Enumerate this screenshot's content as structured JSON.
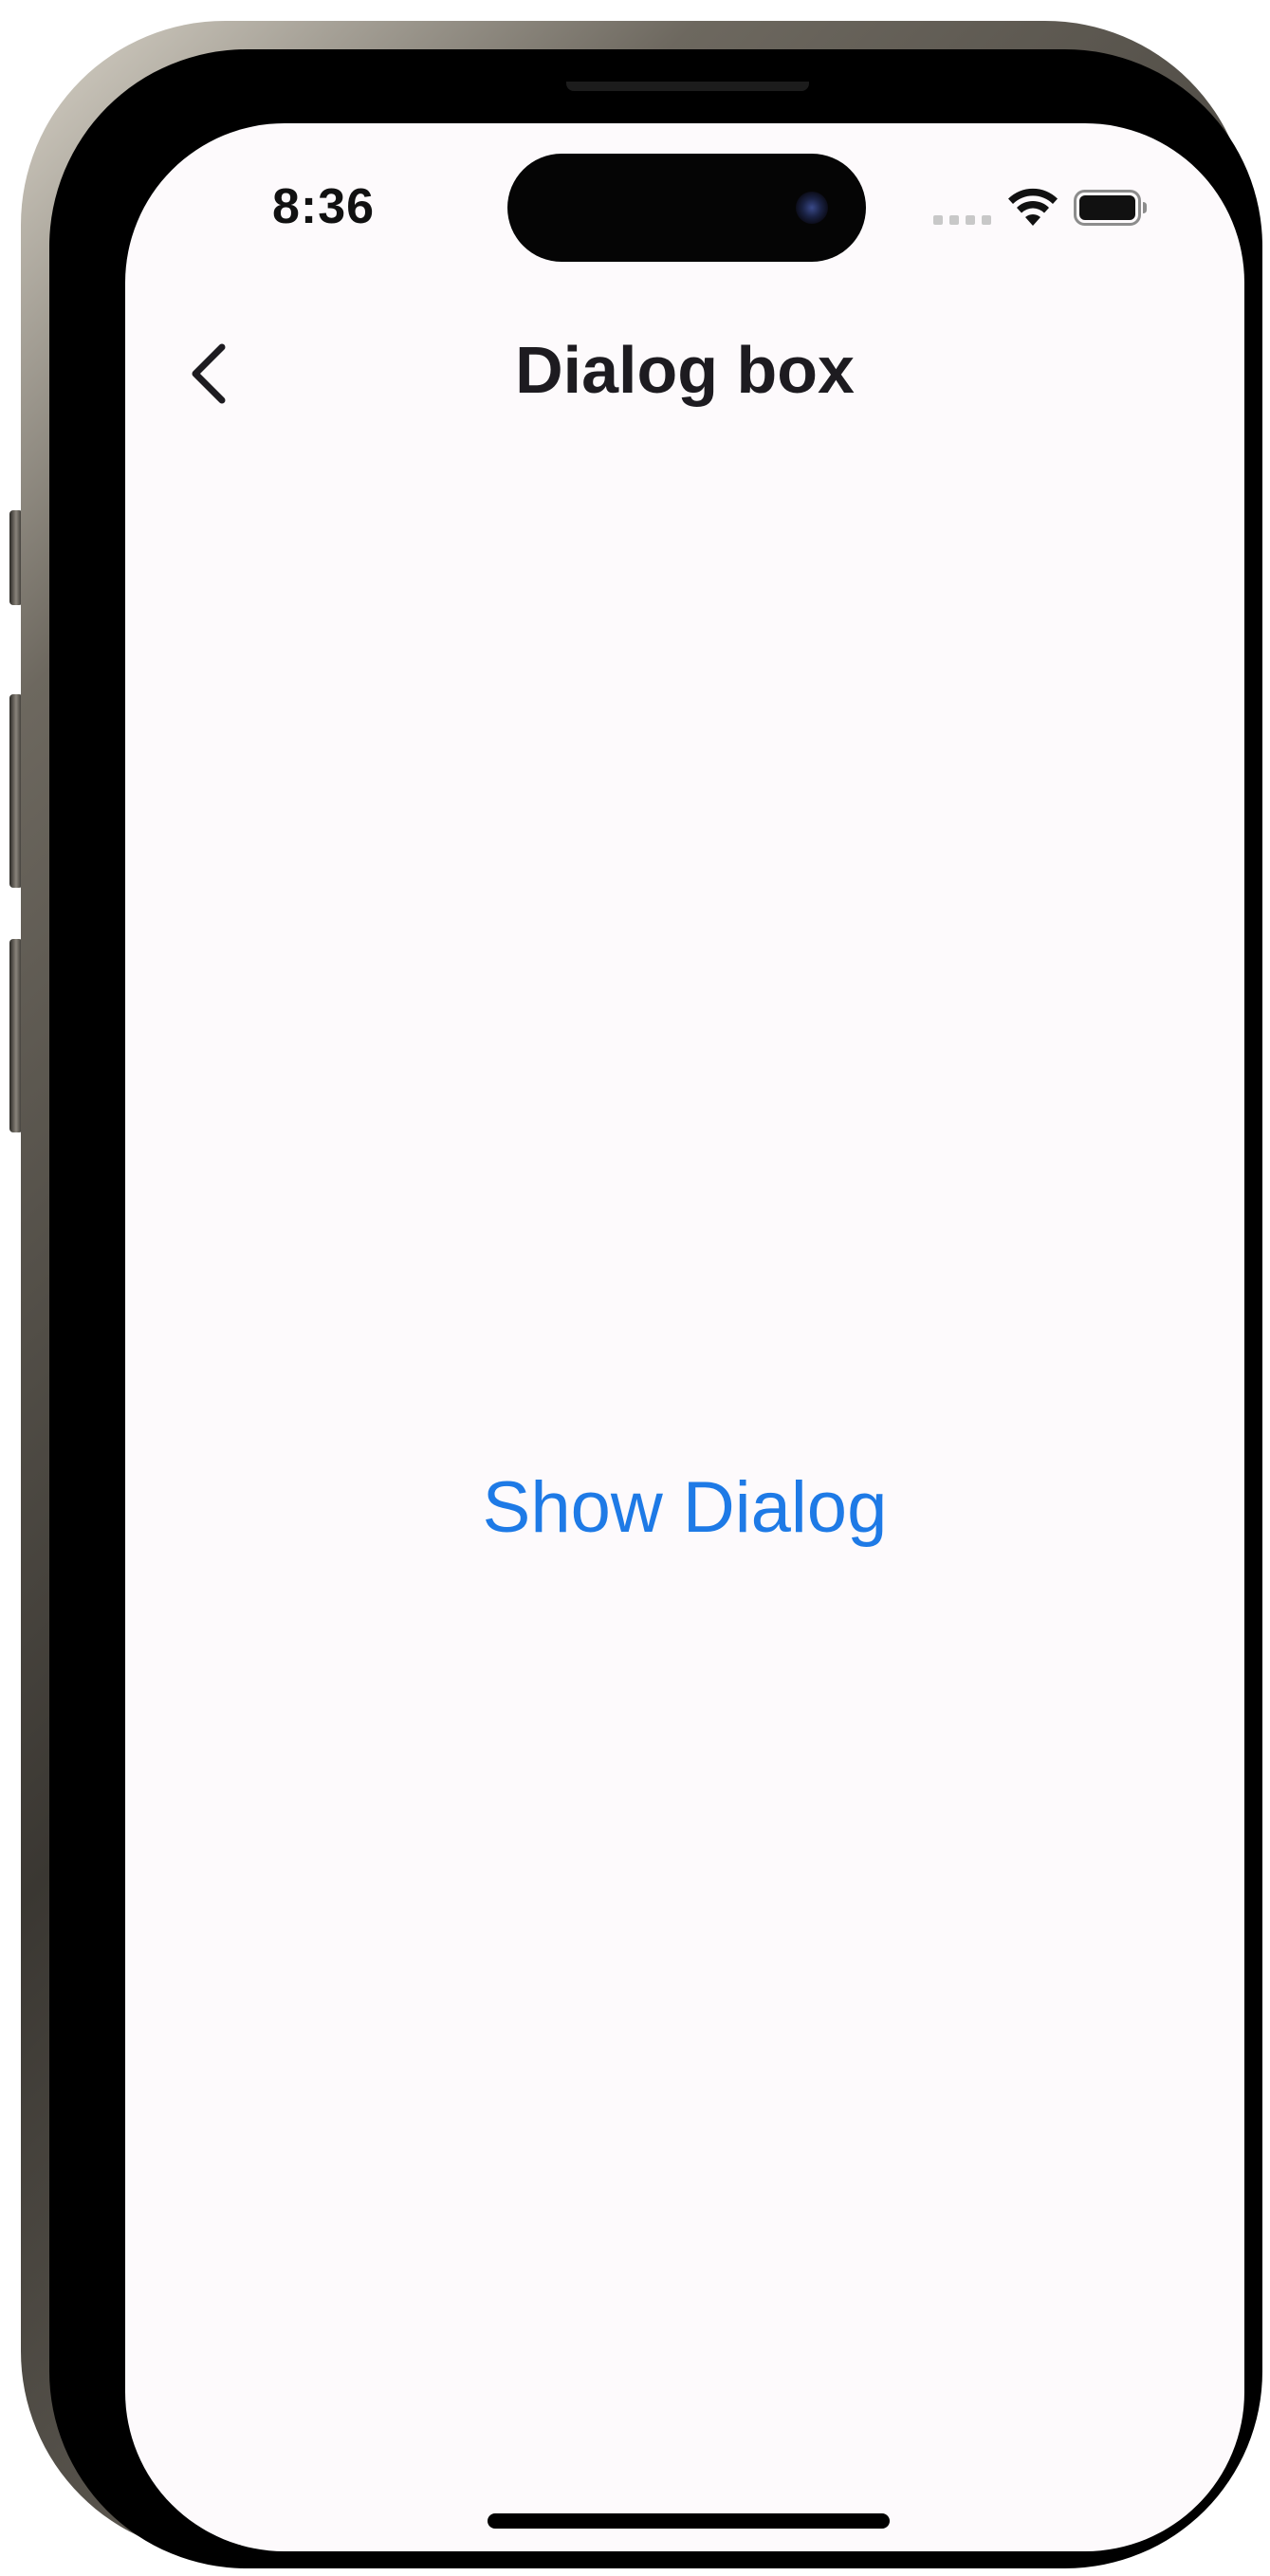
{
  "status_bar": {
    "time": "8:36"
  },
  "nav": {
    "back_icon": "chevron-left-icon",
    "title": "Dialog box"
  },
  "main": {
    "show_dialog_label": "Show Dialog"
  },
  "colors": {
    "accent": "#1e7ae6",
    "screen_background": "#fdfafc",
    "title_text": "#1d1b20"
  }
}
